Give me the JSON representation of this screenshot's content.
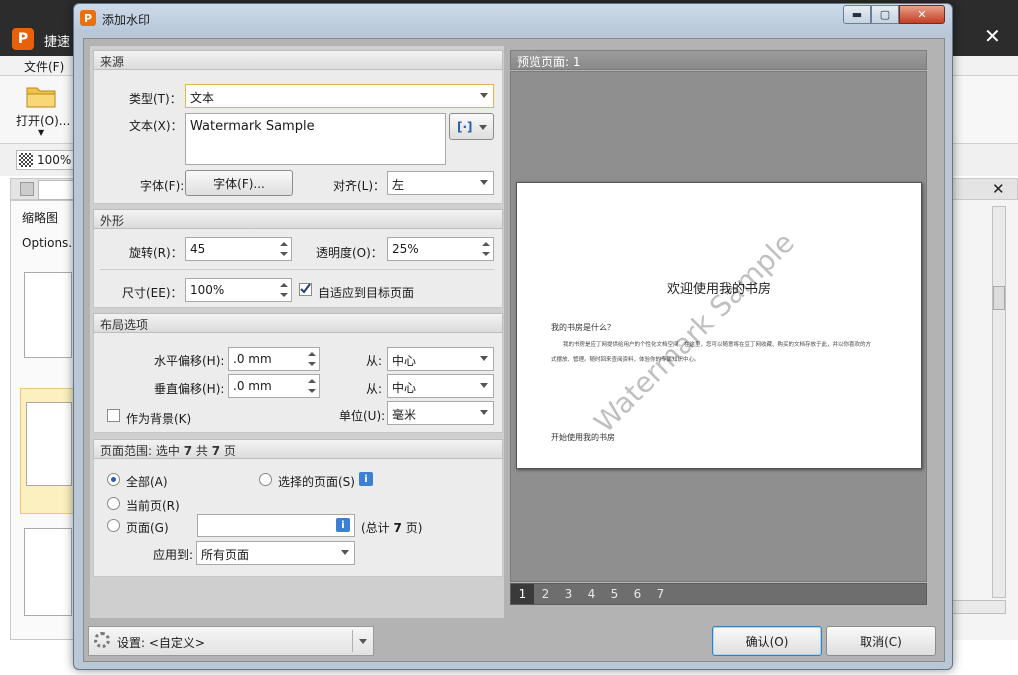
{
  "background_app": {
    "title": "捷速",
    "logo": "P",
    "menu_file": "文件(F)",
    "open_label": "打开(O)...",
    "zoom": "100%",
    "thumbnails_title": "缩略图",
    "options": "Options...",
    "minimize_glyph": "–",
    "close_glyph": "✕"
  },
  "dialog": {
    "title": "添加水印",
    "icon_letter": "P",
    "min_glyph": "▬",
    "max_glyph": "▢",
    "close_glyph": "✕"
  },
  "source": {
    "header": "来源",
    "type_label": "类型(T)：",
    "type_value": "文本",
    "text_label": "文本(X)：",
    "text_value": "Watermark Sample",
    "insert_button": "[·]",
    "font_label": "字体(F):",
    "font_button": "字体(F)...",
    "align_label": "对齐(L)：",
    "align_value": "左"
  },
  "appearance": {
    "header": "外形",
    "rotation_label": "旋转(R)：",
    "rotation_value": "45",
    "opacity_label": "透明度(O)：",
    "opacity_value": "25%",
    "size_label": "尺寸(EE)：",
    "size_value": "100%",
    "fit_label": "自适应到目标页面",
    "fit_checked": true
  },
  "layout": {
    "header": "布局选项",
    "h_offset_label": "水平偏移(H):",
    "h_offset_value": ".0 mm",
    "v_offset_label": "垂直偏移(H):",
    "v_offset_value": ".0 mm",
    "from_label": "从:",
    "h_from_value": "中心",
    "v_from_value": "中心",
    "background_label": "作为背景(K)",
    "unit_label": "单位(U):",
    "unit_value": "毫米"
  },
  "page_range": {
    "header_prefix": "页面范围: 选中",
    "header_selected": "7",
    "header_mid": "共",
    "header_total": "7",
    "header_suffix": "页",
    "all_label": "全部(A)",
    "selected_pages_label": "选择的页面(S)",
    "current_label": "当前页(R)",
    "pages_label": "页面(G)",
    "pages_value": "",
    "total_prefix": "(总计",
    "total_value": "7",
    "total_suffix": "页)",
    "apply_label": "应用到:",
    "apply_value": "所有页面",
    "info_glyph": "i"
  },
  "preview": {
    "header": "预览页面: 1",
    "doc_title": "欢迎使用我的书房",
    "doc_q": "我的书房是什么？",
    "doc_line1": "我的书房是应丁网提供给用户的个性化文档空间。在这里，您可以随意将在豆丁网收藏、购买的文档存放于此，并以你喜欢的方",
    "doc_line2": "式摆放、管理。随时回来查阅资料，体验你的专属知识中心。",
    "doc_start": "开始使用我的书房",
    "watermark": "Watermark Sample",
    "pages": [
      "1",
      "2",
      "3",
      "4",
      "5",
      "6",
      "7"
    ],
    "active_page": "1"
  },
  "footer": {
    "settings_label": "设置: <自定义>",
    "ok_button": "确认(O)",
    "cancel_button": "取消(C)"
  }
}
